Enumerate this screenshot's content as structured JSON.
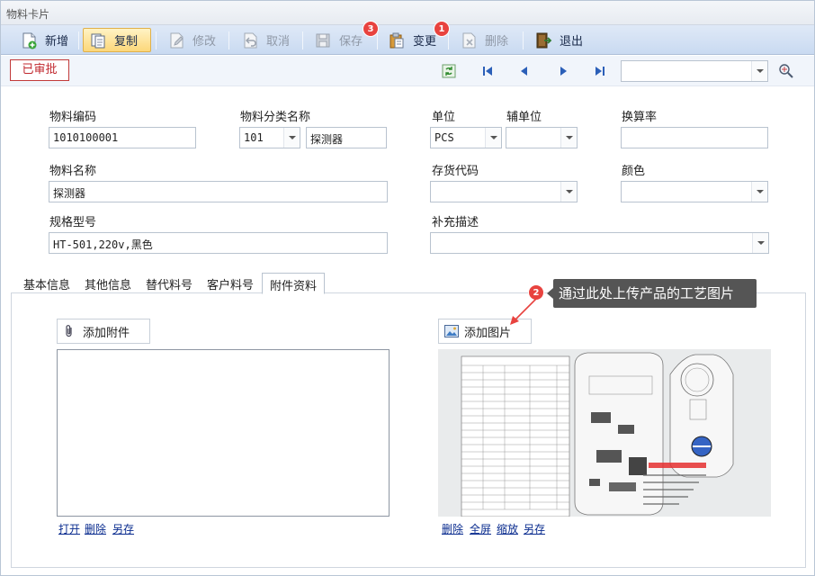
{
  "window": {
    "title": "物料卡片"
  },
  "toolbar": {
    "new_label": "新增",
    "copy_label": "复制",
    "modify_label": "修改",
    "cancel_label": "取消",
    "save_label": "保存",
    "change_label": "变更",
    "delete_label": "删除",
    "exit_label": "退出",
    "badge_save": "3",
    "badge_change": "1"
  },
  "status": {
    "stamp": "已审批"
  },
  "form": {
    "code_label": "物料编码",
    "code_value": "1010100001",
    "category_label": "物料分类名称",
    "category_code": "101",
    "category_name": "探测器",
    "unit_label": "单位",
    "unit_value": "PCS",
    "aux_unit_label": "辅单位",
    "conversion_label": "换算率",
    "name_label": "物料名称",
    "name_value": "探测器",
    "stock_code_label": "存货代码",
    "color_label": "颜色",
    "spec_label": "规格型号",
    "spec_value": "HT-501,220v,黑色",
    "supplement_label": "补充描述"
  },
  "tabs": {
    "basic": "基本信息",
    "other": "其他信息",
    "substitute": "替代料号",
    "customer": "客户料号",
    "attachment": "附件资料"
  },
  "attachments": {
    "add_attachment": "添加附件",
    "add_image": "添加图片",
    "open": "打开",
    "delete": "删除",
    "save_as": "另存",
    "img_delete": "删除",
    "fullscreen": "全屏",
    "zoom": "缩放",
    "img_save_as": "另存",
    "badge_hint": "2",
    "hint": "通过此处上传产品的工艺图片"
  },
  "colors": {
    "toolbar_top": "#dfe9f7",
    "badge": "#e8433f",
    "stamp": "#c0272d",
    "link": "#0a2c8f",
    "callout": "#555555"
  }
}
